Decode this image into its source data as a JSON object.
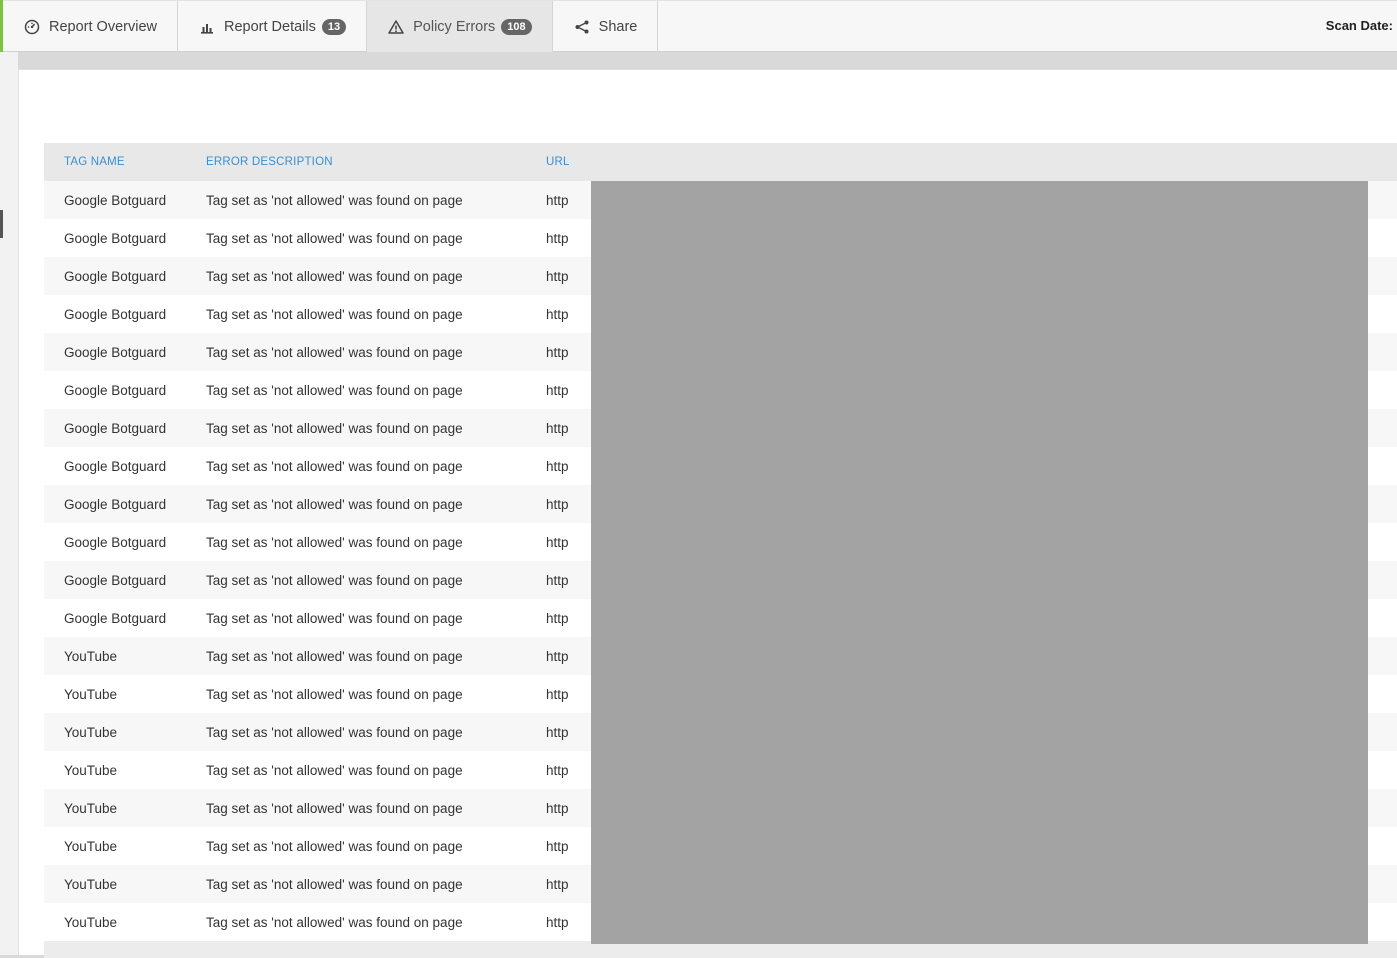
{
  "tabs": [
    {
      "label": "Report Overview",
      "icon": "gauge-icon"
    },
    {
      "label": "Report Details",
      "icon": "bar-chart-icon",
      "badge": "13"
    },
    {
      "label": "Policy Errors",
      "icon": "warning-icon",
      "badge": "108",
      "active": true
    },
    {
      "label": "Share",
      "icon": "share-icon"
    }
  ],
  "scan_date_label": "Scan Date:",
  "table": {
    "headers": [
      "TAG NAME",
      "ERROR DESCRIPTION",
      "URL"
    ],
    "rows": [
      {
        "tag": "Google Botguard",
        "desc": "Tag set as 'not allowed' was found on page",
        "url": "http"
      },
      {
        "tag": "Google Botguard",
        "desc": "Tag set as 'not allowed' was found on page",
        "url": "http"
      },
      {
        "tag": "Google Botguard",
        "desc": "Tag set as 'not allowed' was found on page",
        "url": "http"
      },
      {
        "tag": "Google Botguard",
        "desc": "Tag set as 'not allowed' was found on page",
        "url": "http"
      },
      {
        "tag": "Google Botguard",
        "desc": "Tag set as 'not allowed' was found on page",
        "url": "http"
      },
      {
        "tag": "Google Botguard",
        "desc": "Tag set as 'not allowed' was found on page",
        "url": "http"
      },
      {
        "tag": "Google Botguard",
        "desc": "Tag set as 'not allowed' was found on page",
        "url": "http"
      },
      {
        "tag": "Google Botguard",
        "desc": "Tag set as 'not allowed' was found on page",
        "url": "http"
      },
      {
        "tag": "Google Botguard",
        "desc": "Tag set as 'not allowed' was found on page",
        "url": "http"
      },
      {
        "tag": "Google Botguard",
        "desc": "Tag set as 'not allowed' was found on page",
        "url": "http"
      },
      {
        "tag": "Google Botguard",
        "desc": "Tag set as 'not allowed' was found on page",
        "url": "http"
      },
      {
        "tag": "Google Botguard",
        "desc": "Tag set as 'not allowed' was found on page",
        "url": "http"
      },
      {
        "tag": "YouTube",
        "desc": "Tag set as 'not allowed' was found on page",
        "url": "http"
      },
      {
        "tag": "YouTube",
        "desc": "Tag set as 'not allowed' was found on page",
        "url": "http"
      },
      {
        "tag": "YouTube",
        "desc": "Tag set as 'not allowed' was found on page",
        "url": "http"
      },
      {
        "tag": "YouTube",
        "desc": "Tag set as 'not allowed' was found on page",
        "url": "http"
      },
      {
        "tag": "YouTube",
        "desc": "Tag set as 'not allowed' was found on page",
        "url": "http"
      },
      {
        "tag": "YouTube",
        "desc": "Tag set as 'not allowed' was found on page",
        "url": "http"
      },
      {
        "tag": "YouTube",
        "desc": "Tag set as 'not allowed' was found on page",
        "url": "http"
      },
      {
        "tag": "YouTube",
        "desc": "Tag set as 'not allowed' was found on page",
        "url": "http"
      }
    ]
  },
  "colors": {
    "accent": "#7dc242",
    "header_link": "#3a8fd0",
    "redaction": "#a3a3a3"
  }
}
